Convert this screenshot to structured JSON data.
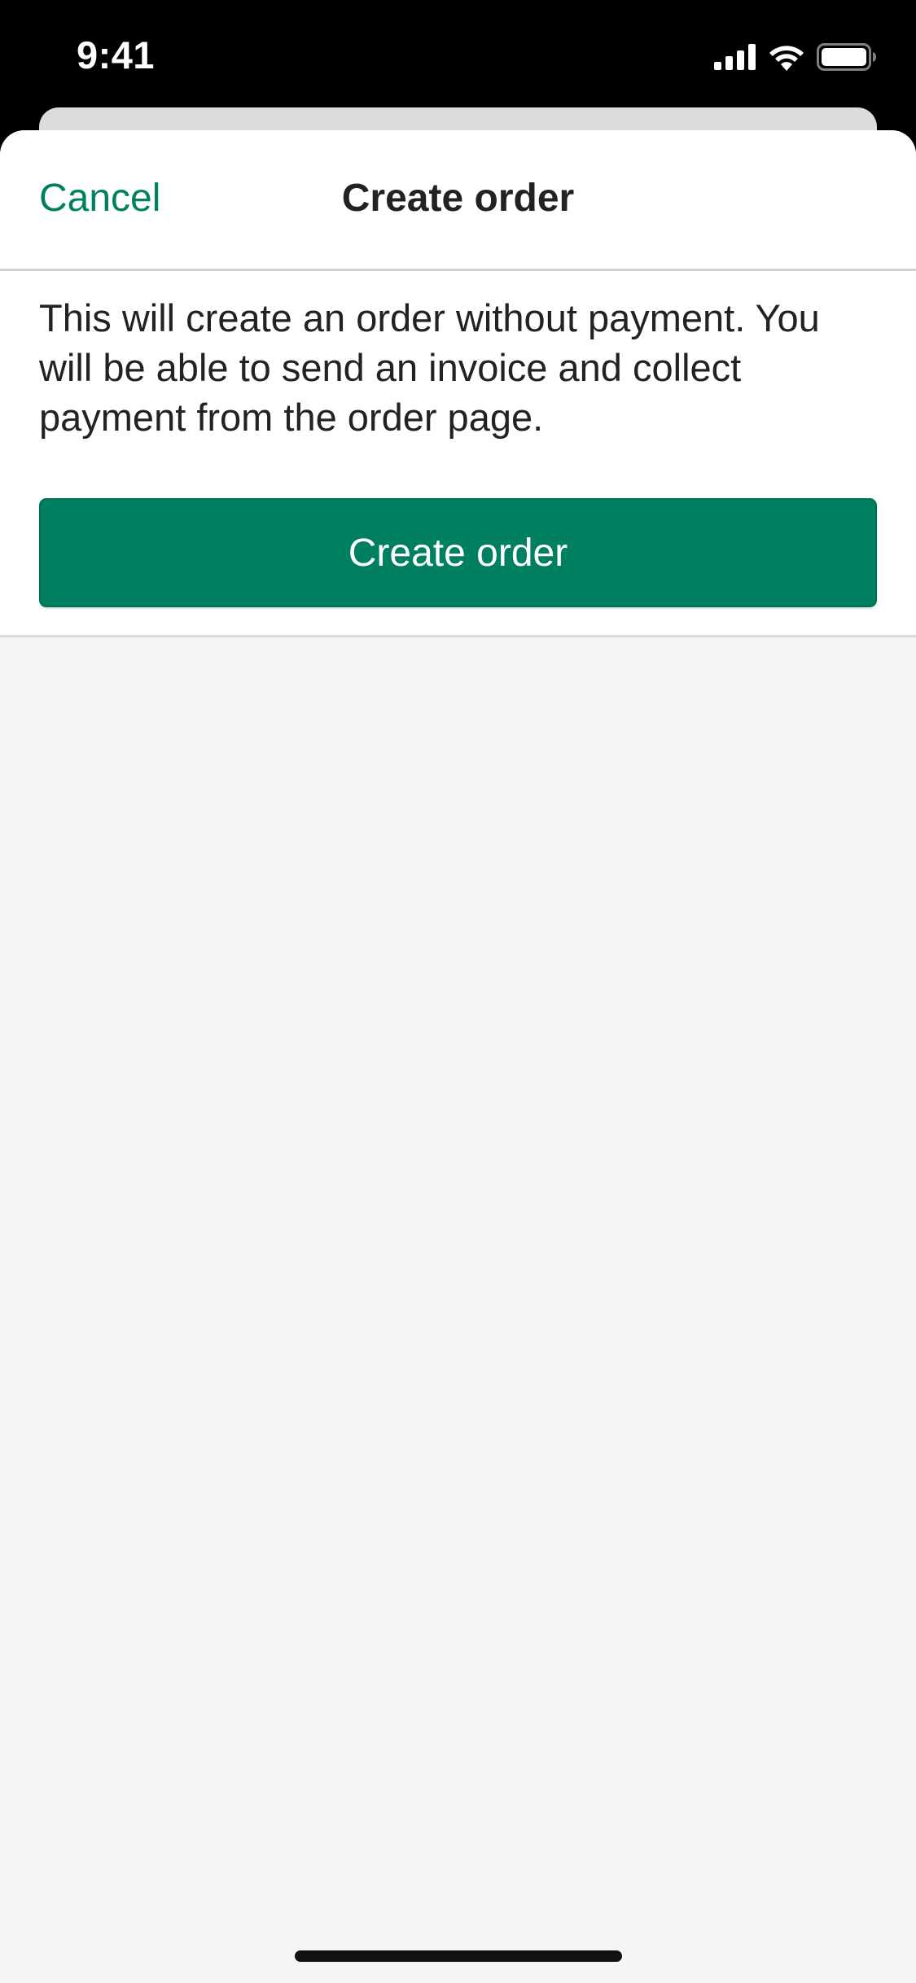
{
  "status_bar": {
    "time": "9:41",
    "icons": [
      "cellular-signal-icon",
      "wifi-icon",
      "battery-icon"
    ]
  },
  "nav": {
    "cancel_label": "Cancel",
    "title": "Create order"
  },
  "content": {
    "description": "This will create an order without payment. You will be able to send an invoice and collect payment from the order page.",
    "create_button_label": "Create order"
  },
  "colors": {
    "accent": "#008060",
    "text": "#202223",
    "background": "#f5f5f5"
  }
}
